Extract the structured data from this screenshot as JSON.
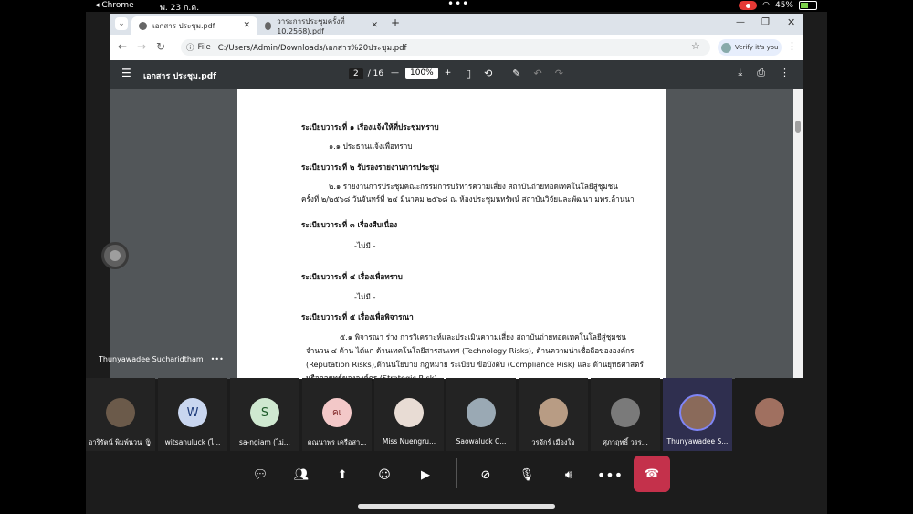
{
  "status_bar": {
    "app": "◂ Chrome",
    "date": "พ. 23 ก.ค.",
    "battery": "45%"
  },
  "browser": {
    "tabs": [
      {
        "label": "เอกสาร ประชุม.pdf",
        "active": true
      },
      {
        "label": "วาระการประชุมครั้งที่ 10.2568).pdf",
        "active": false
      }
    ],
    "new_tab": "+",
    "url_prefix": "File",
    "url": "C:/Users/Admin/Downloads/เอกสาร%20ประชุม.pdf",
    "verify": "Verify it's you"
  },
  "pdf": {
    "title": "เอกสาร ประชุม.pdf",
    "page_current": "2",
    "page_total": "/ 16",
    "zoom": "100%",
    "lines": [
      "ระเบียบวาระที่ ๑ เรื่องแจ้งให้ที่ประชุมทราบ",
      "๑.๑ ประธานแจ้งเพื่อทราบ",
      "ระเบียบวาระที่ ๒ รับรองรายงานการประชุม",
      "๒.๑ รายงานการประชุมคณะกรรมการบริหารความเสี่ยง สถาบันถ่ายทอดเทคโนโลยีสู่ชุมชน",
      "ครั้งที่ ๒/๒๕๖๘ วันจันทร์ที่ ๒๔ มีนาคม ๒๕๖๘ ณ ห้องประชุมนทรัพน์ สถาบันวิจัยและพัฒนา มทร.ล้านนา",
      "ระเบียบวาระที่ ๓ เรื่องสืบเนื่อง",
      "-ไม่มี -",
      "ระเบียบวาระที่ ๔ เรื่องเพื่อทราบ",
      "-ไม่มี -",
      "ระเบียบวาระที่ ๕ เรื่องเพื่อพิจารณา",
      "๕.๑ พิจารณา ร่าง การวิเคราะห์และประเมินความเสี่ยง สถาบันถ่ายทอดเทคโนโลยีสู่ชุมชน",
      "จำนวน ๔ ด้าน ได้แก่ ด้านเทคโนโลยีสารสนเทศ (Technology Risks), ด้านความน่าเชื่อถือขององค์กร",
      "(Reputation Risks),ด้านนโยบาย กฎหมาย ระเบียบ ข้อบังคับ (Compliance Risk) และ ด้านยุทธศาสตร์",
      "หรือกลยุทธ์ขององค์กร (Strategic Risk)"
    ]
  },
  "presenter": {
    "name": "Thunyawadee Sucharidtham",
    "more": "•••"
  },
  "participants": [
    {
      "name": "อาริรัตน์ พิมพ์นวน 🎙",
      "initials": "",
      "color": "#6b5a4a"
    },
    {
      "name": "witsanuluck (ไ...",
      "initials": "W",
      "color": "#c9d6ef"
    },
    {
      "name": "sa-ngiam (ไม่...",
      "initials": "S",
      "color": "#cfe8d0"
    },
    {
      "name": "คณนาพร เครือสา...",
      "initials": "คเ",
      "color": "#f3c8c8"
    },
    {
      "name": "Miss Nuengru...",
      "initials": "",
      "color": "#e8dcd4"
    },
    {
      "name": "Saowaluck  C...",
      "initials": "",
      "color": "#9aa9b4"
    },
    {
      "name": "วรจักร์ เมืองใจ",
      "initials": "",
      "color": "#b89c84"
    },
    {
      "name": "ศุภาฤทธิ์ วรร...",
      "initials": "",
      "color": "#7a7a7a"
    },
    {
      "name": "Thunyawadee S...",
      "initials": "",
      "color": "#8a6a5a"
    },
    {
      "name": "",
      "initials": "",
      "color": "#a07060"
    }
  ],
  "controls": [
    "chat",
    "people",
    "share",
    "react",
    "view",
    "camera-off",
    "mic-off",
    "speaker",
    "more",
    "end-call"
  ],
  "colors": {
    "end_call": "#c4314b",
    "active_tile": "#2f2f4f",
    "pdf_toolbar": "#323639"
  }
}
